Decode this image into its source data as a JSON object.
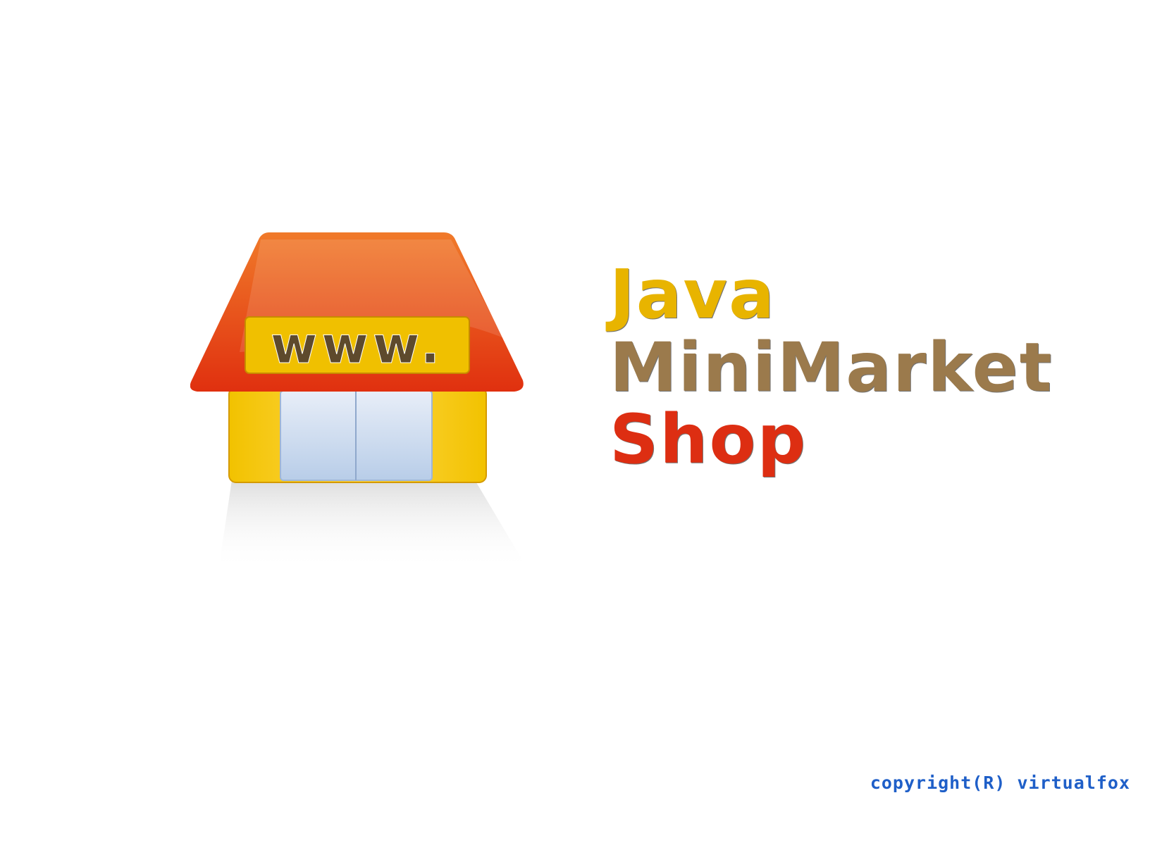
{
  "logo": {
    "icon": "shop-icon",
    "sign_text": "www.",
    "colors": {
      "roof": "#e0300f",
      "roof_top": "#f07a2a",
      "walls": "#f2c200",
      "window": "#b8cde8",
      "sign_bg": "#f0c000",
      "sign_text": "#5e4a2c"
    }
  },
  "title": {
    "line1": "Java",
    "line2": "MiniMarket",
    "line3": "Shop",
    "colors": {
      "line1": "#e8b400",
      "line2": "#9b7a4c",
      "line3": "#dd2e12"
    }
  },
  "footer": {
    "copyright": "copyright(R) virtualfox",
    "color": "#1f5fc8"
  }
}
